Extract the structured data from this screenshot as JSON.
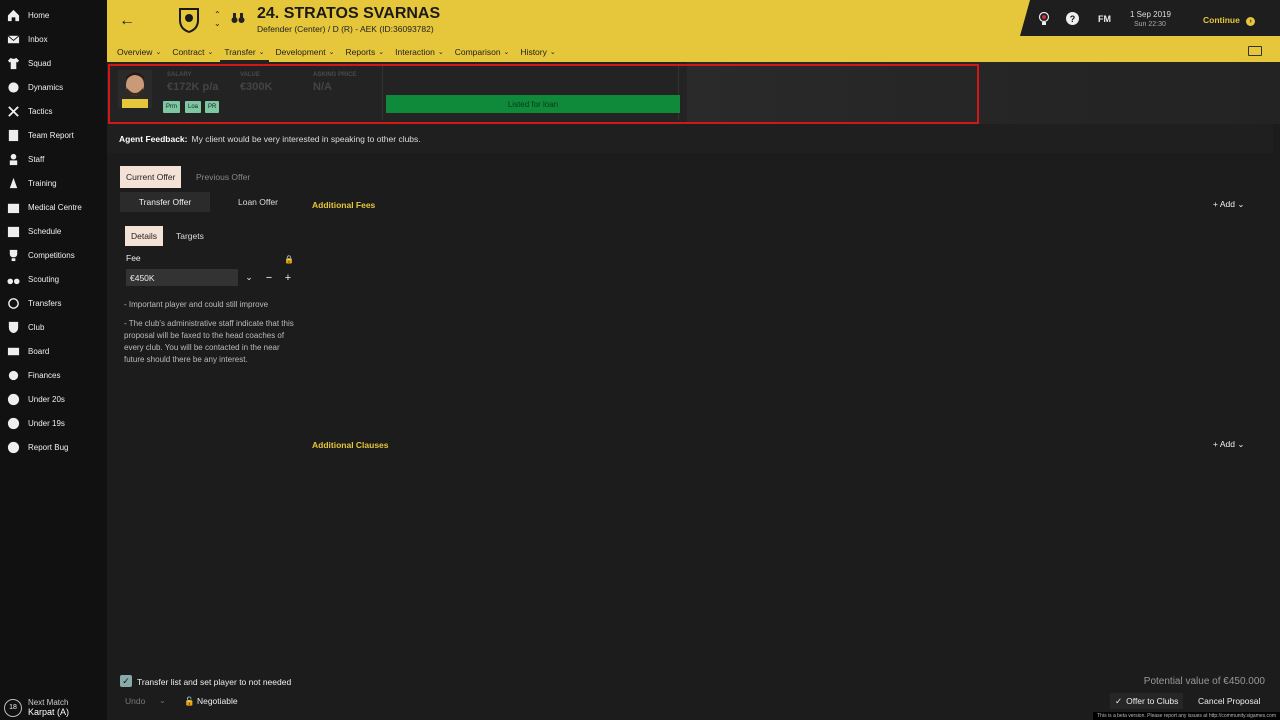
{
  "sidebar": {
    "items": [
      {
        "label": "Home",
        "icon": "home-icon"
      },
      {
        "label": "Inbox",
        "icon": "mail-icon"
      },
      {
        "label": "Squad",
        "icon": "shirt-icon"
      },
      {
        "label": "Dynamics",
        "icon": "dynamics-icon"
      },
      {
        "label": "Tactics",
        "icon": "tactics-icon"
      },
      {
        "label": "Team Report",
        "icon": "report-icon"
      },
      {
        "label": "Staff",
        "icon": "staff-icon"
      },
      {
        "label": "Training",
        "icon": "cone-icon"
      },
      {
        "label": "Medical Centre",
        "icon": "medical-icon"
      },
      {
        "label": "Schedule",
        "icon": "calendar-icon"
      },
      {
        "label": "Competitions",
        "icon": "trophy-icon"
      },
      {
        "label": "Scouting",
        "icon": "binoculars-icon"
      },
      {
        "label": "Transfers",
        "icon": "transfers-icon"
      },
      {
        "label": "Club",
        "icon": "club-badge-icon"
      },
      {
        "label": "Board",
        "icon": "board-icon"
      },
      {
        "label": "Finances",
        "icon": "finances-icon"
      },
      {
        "label": "Under 20s",
        "icon": "team-icon"
      },
      {
        "label": "Under 19s",
        "icon": "team-icon"
      },
      {
        "label": "Report Bug",
        "icon": "alert-icon"
      }
    ],
    "next_match": {
      "badge": "18",
      "title": "Next Match",
      "opponent": "Karpat (A)"
    }
  },
  "header": {
    "player_title": "24. STRATOS SVARNAS",
    "player_sub": "Defender (Center) / D (R) - AEK (ID:36093782)",
    "date": "1 Sep 2019",
    "time": "Sun 22:30",
    "fm_label": "FM",
    "help_label": "?",
    "continue_label": "Continue"
  },
  "tabs": [
    {
      "label": "Overview"
    },
    {
      "label": "Contract"
    },
    {
      "label": "Transfer"
    },
    {
      "label": "Development"
    },
    {
      "label": "Reports"
    },
    {
      "label": "Interaction"
    },
    {
      "label": "Comparison"
    },
    {
      "label": "History"
    }
  ],
  "info_strip": {
    "tags": [
      "Prm",
      "Loa",
      "PR"
    ],
    "salary_label": "SALARY",
    "salary_value": "€172K p/a",
    "value_label": "VALUE",
    "value_value": "€300K",
    "third_label": "ASKING PRICE",
    "third_value": "N/A",
    "loan_status": "Listed for loan"
  },
  "agent": {
    "label": "Agent Feedback:",
    "text": "My client would be very interested in speaking to other clubs."
  },
  "offer": {
    "tab_current": "Current Offer",
    "tab_previous": "Previous Offer",
    "seg_transfer": "Transfer Offer",
    "seg_loan": "Loan Offer",
    "sub_details": "Details",
    "sub_targets": "Targets",
    "fee_label": "Fee",
    "fee_value": "€450K",
    "note1": "- Important player and could still improve",
    "note2": "- The club's administrative staff indicate that this proposal will be faxed to the head coaches of every club. You will be contacted in the near future should there be any interest."
  },
  "sections": {
    "fees_title": "Additional Fees",
    "clauses_title": "Additional Clauses",
    "add_label": "Add"
  },
  "bottom": {
    "checkbox_label": "Transfer list and set player to not needed",
    "undo_label": "Undo",
    "negotiable_label": "Negotiable",
    "potential": "Potential value of €450.000",
    "offer_btn": "Offer to Clubs",
    "cancel_btn": "Cancel Proposal",
    "beta": "This is a beta version. Please report any issues at http://community.sigames.com"
  },
  "colors": {
    "accent": "#e6c63a",
    "loan_green": "#0f8a3a",
    "highlight": "#d01818"
  }
}
